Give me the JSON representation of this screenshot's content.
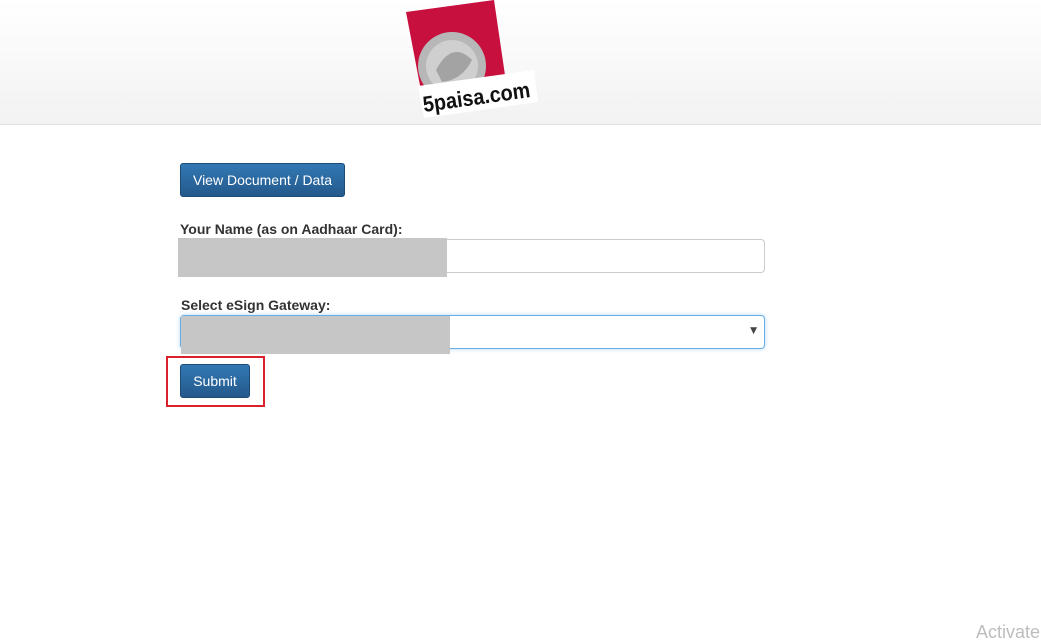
{
  "header": {
    "logo_text": "5paisa.com",
    "logo_colors": {
      "red": "#c8103e",
      "coin": "#b5b5b5"
    }
  },
  "form": {
    "view_button_label": "View Document / Data",
    "name_label": "Your Name (as on Aadhaar Card):",
    "name_value": "",
    "gateway_label": "Select eSign Gateway:",
    "gateway_selected": "",
    "submit_label": "Submit"
  },
  "overlay": {
    "watermark_text": "Activate",
    "highlight_color": "#d9212b"
  },
  "colors": {
    "button_primary": "#286090",
    "label_text": "#333333"
  }
}
